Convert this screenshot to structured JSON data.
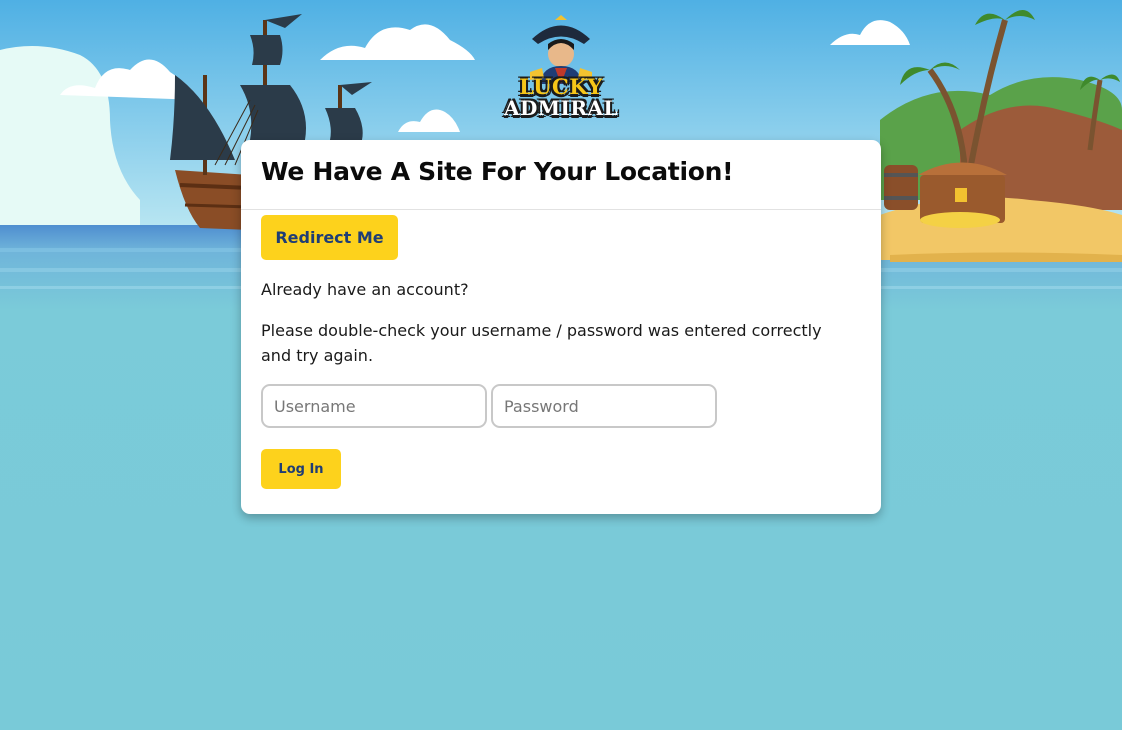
{
  "brand": {
    "logo_line1": "LUCKY",
    "logo_line2": "ADMIRAL"
  },
  "modal": {
    "title": "We Have A Site For Your Location!",
    "redirect_label": "Redirect Me",
    "account_prompt": "Already have an account?",
    "error_message": "Please double-check your username / password was entered correctly and try again.",
    "username": {
      "value": "",
      "placeholder": "Username"
    },
    "password": {
      "value": "",
      "placeholder": "Password"
    },
    "login_label": "Log In"
  },
  "colors": {
    "accent_yellow": "#fdd21c",
    "button_text_navy": "#1f3d75",
    "sea": "#7bcbd9",
    "sky": "#57b8e6"
  }
}
